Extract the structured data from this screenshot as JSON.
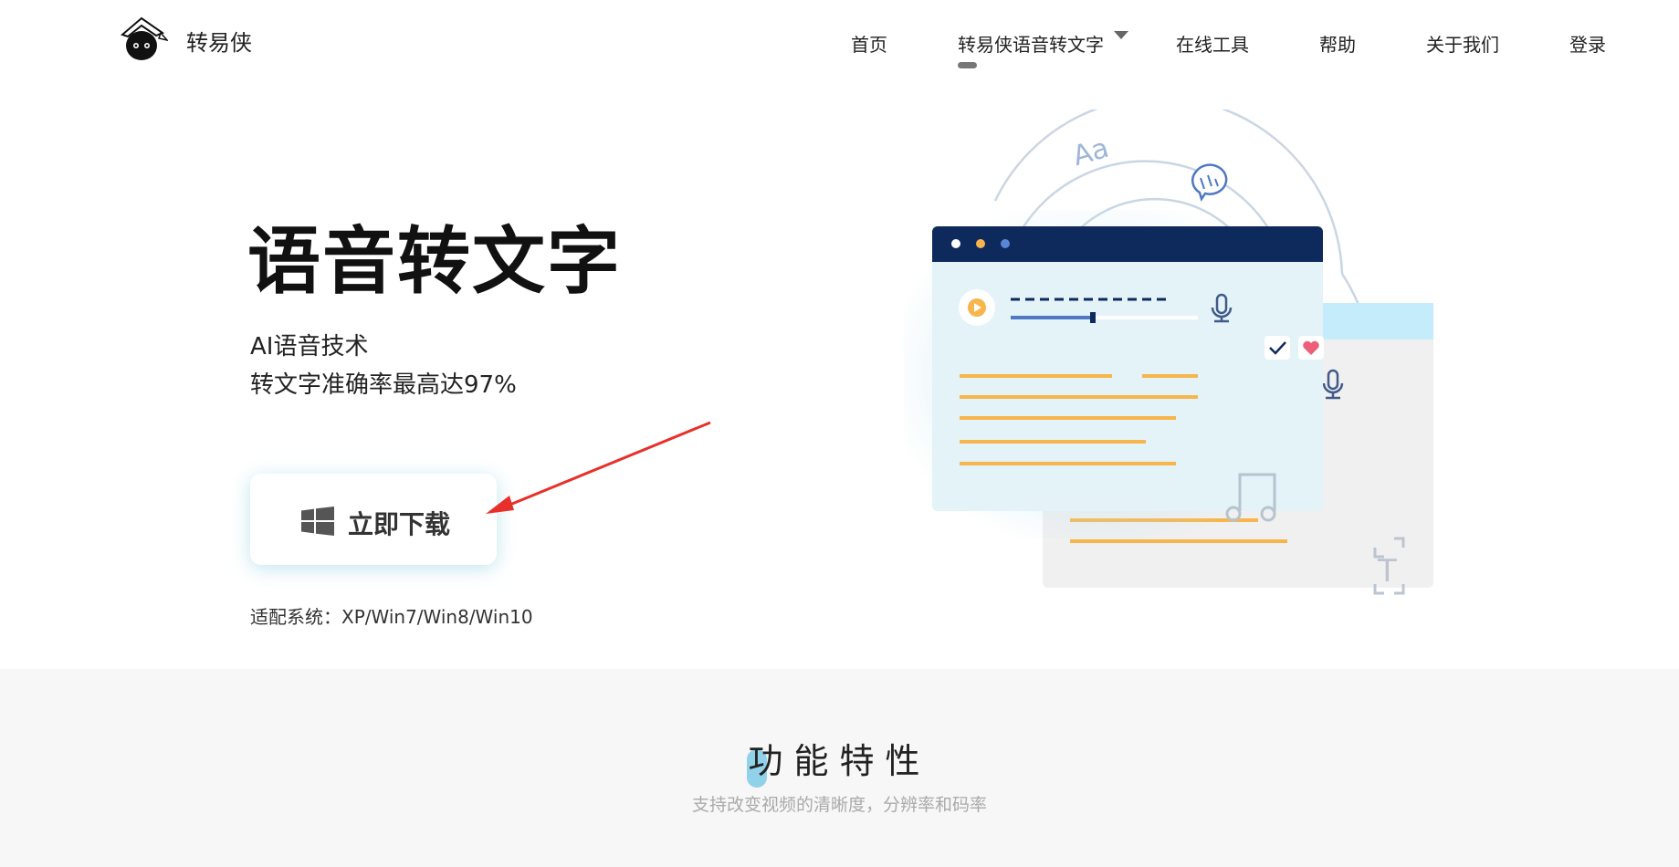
{
  "header": {
    "brand": "转易侠",
    "nav": [
      {
        "label": "首页"
      },
      {
        "label": "转易侠语音转文字"
      },
      {
        "label": "在线工具"
      },
      {
        "label": "帮助"
      },
      {
        "label": "关于我们"
      },
      {
        "label": "登录"
      }
    ],
    "active_index": 1
  },
  "hero": {
    "title": "语音转文字",
    "subtitle_lines": [
      "AI语音技术",
      "转文字准确率最高达97%"
    ],
    "download_label": "立即下载",
    "compat": "适配系统：XP/Win7/Win8/Win10"
  },
  "features": {
    "title": "功能特性",
    "subtitle": "支持改变视频的清晰度，分辨率和码率"
  },
  "icons": {
    "logo": "ninja-mascot-logo",
    "windows": "windows-icon",
    "caret": "caret-down-icon",
    "arrow": "red-arrow-annotation",
    "illustration": "speech-to-text-illustration"
  },
  "colors": {
    "navy": "#0e2a5c",
    "accent_orange": "#f7b54b",
    "panel_bg": "#e3f3f7",
    "annotation_red": "#e8302a"
  }
}
